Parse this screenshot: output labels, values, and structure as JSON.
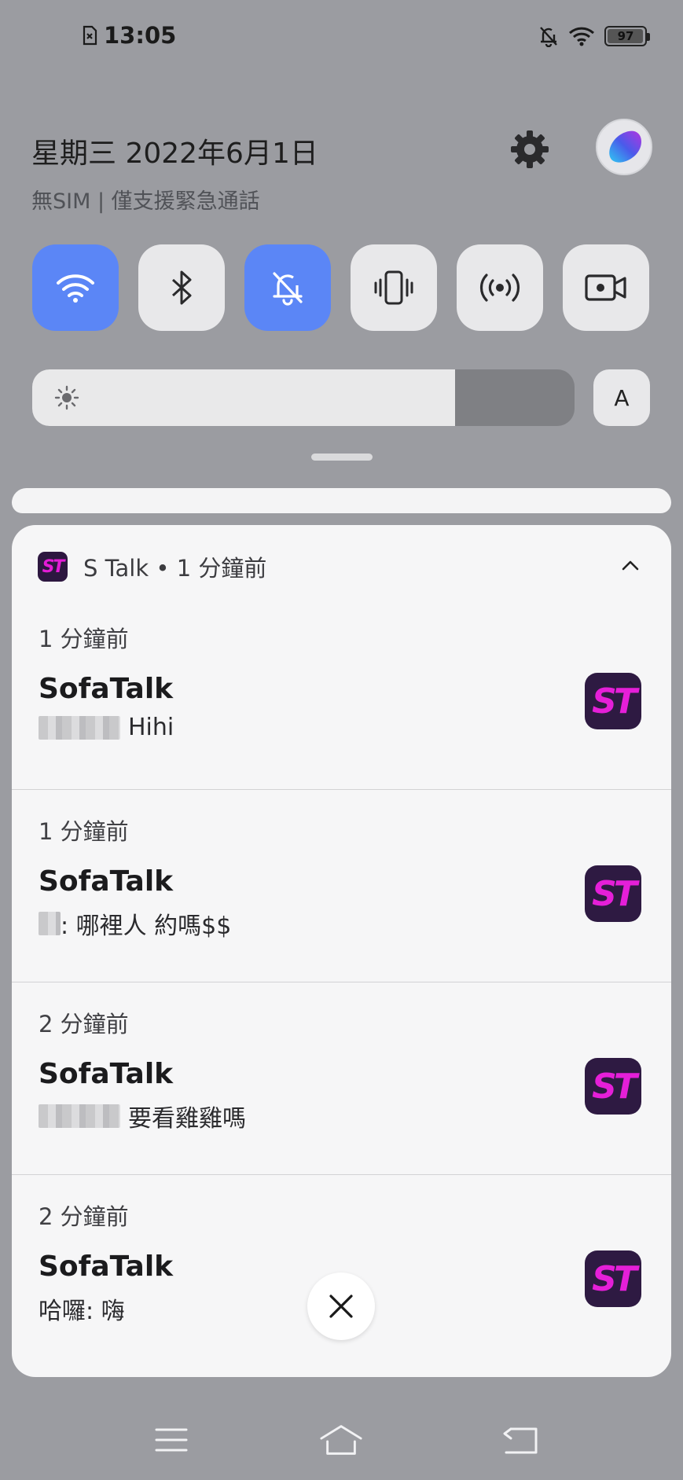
{
  "status_bar": {
    "time": "13:05",
    "sim_icon": "no-sim-icon",
    "icons": [
      "bell-off-icon",
      "wifi-icon"
    ],
    "battery": "97",
    "battery_level": 0.97
  },
  "header": {
    "date": "星期三 2022年6月1日",
    "sim_status": "無SIM | 僅支援緊急通話",
    "settings_icon": "gear-icon",
    "avatar_icon": "account-avatar-icon"
  },
  "quick_tiles": [
    {
      "name": "wifi",
      "icon": "wifi-icon",
      "active": true
    },
    {
      "name": "bluetooth",
      "icon": "bluetooth-icon",
      "active": false
    },
    {
      "name": "mute",
      "icon": "bell-off-icon",
      "active": true
    },
    {
      "name": "vibrate",
      "icon": "vibrate-icon",
      "active": false
    },
    {
      "name": "hotspot",
      "icon": "hotspot-icon",
      "active": false
    },
    {
      "name": "screen-record",
      "icon": "screen-record-icon",
      "active": false
    }
  ],
  "brightness": {
    "level": 0.78,
    "auto_label": "A"
  },
  "colors": {
    "accent": "#5b86f6",
    "st_brand": "#e51fd8",
    "st_bg": "#2e1a42"
  },
  "notification_group": {
    "app_name": "S Talk",
    "separator": "•",
    "group_time": "1 分鐘前",
    "items": [
      {
        "time": "1 分鐘前",
        "title": "SofaTalk",
        "message": "Hihi"
      },
      {
        "time": "1 分鐘前",
        "title": "SofaTalk",
        "message": ": 哪裡人 約嗎$$"
      },
      {
        "time": "2 分鐘前",
        "title": "SofaTalk",
        "message": "要看雞雞嗎"
      },
      {
        "time": "2 分鐘前",
        "title": "SofaTalk",
        "message": "哈囉: 嗨"
      }
    ],
    "icon_text": "ST"
  },
  "navbar": {
    "icons": [
      "menu-icon",
      "home-icon",
      "back-icon"
    ]
  }
}
